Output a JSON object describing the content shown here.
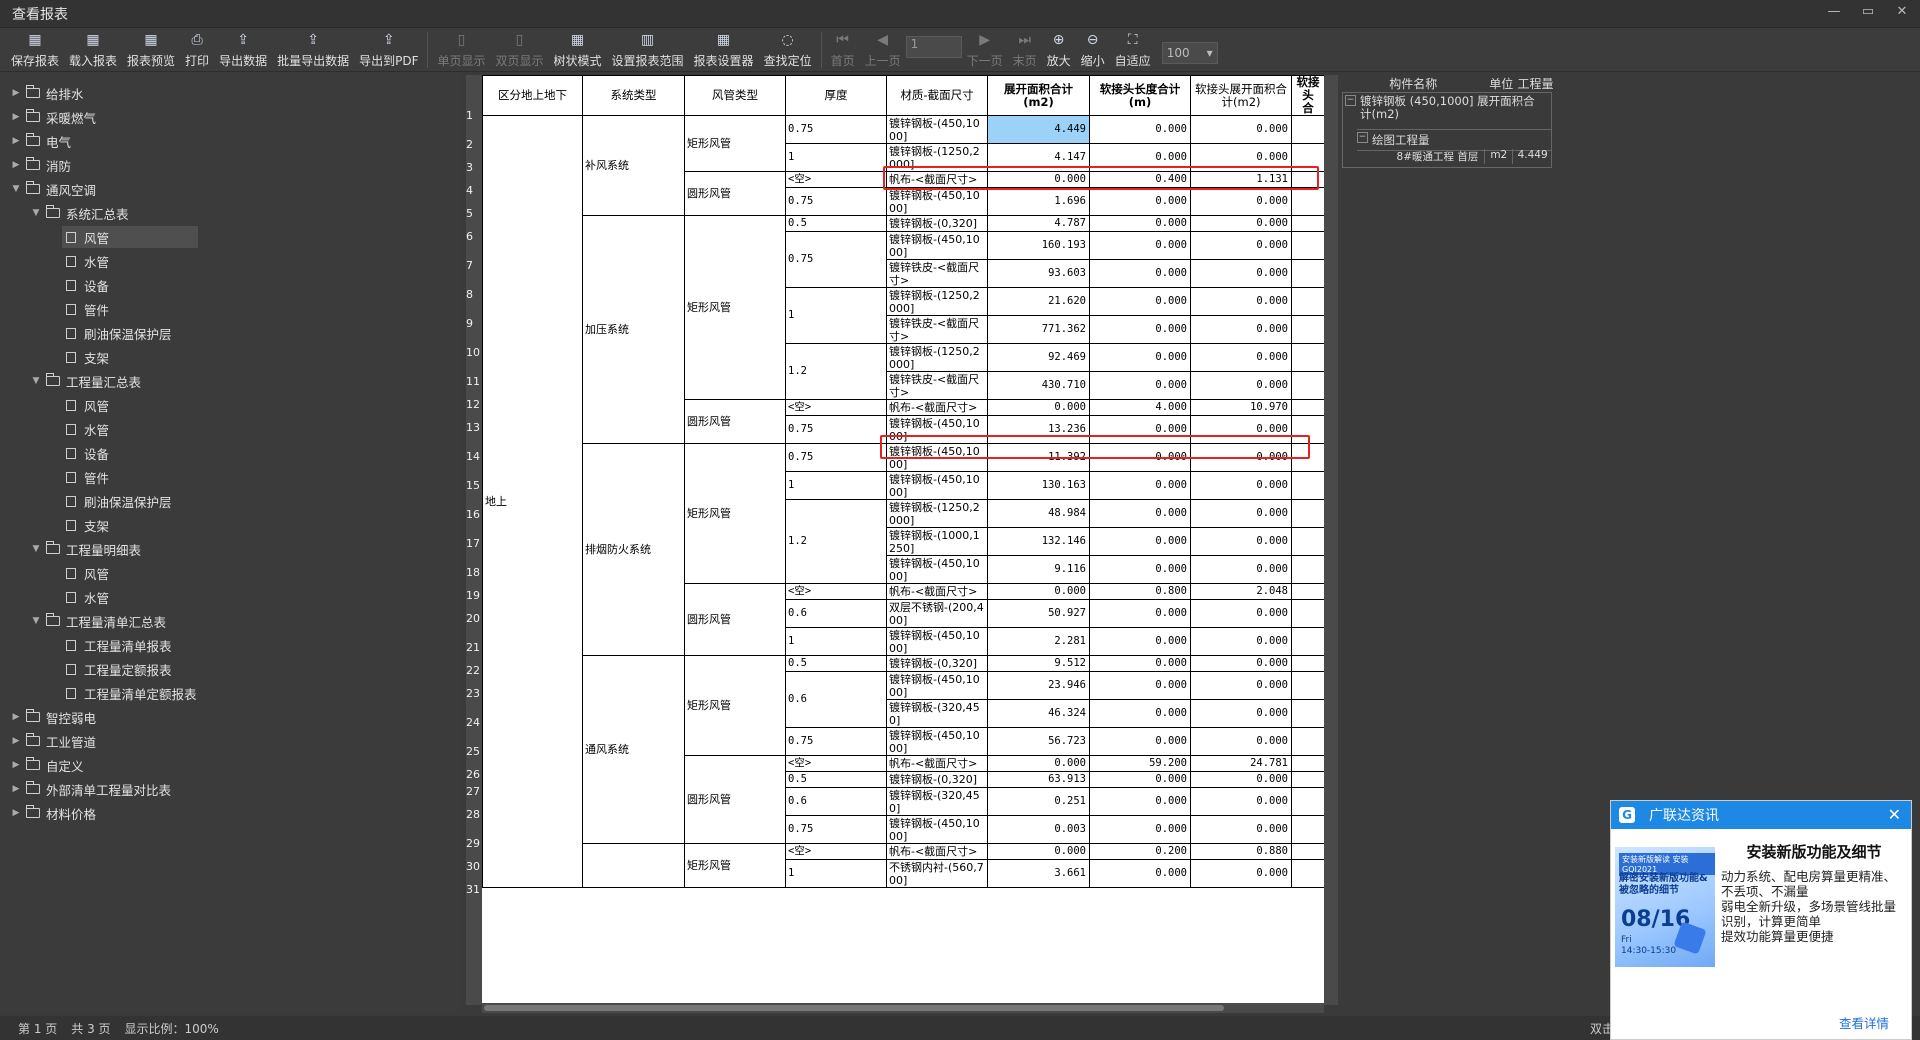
{
  "window": {
    "title": "查看报表",
    "controls": [
      "—",
      "▭",
      "✕"
    ]
  },
  "toolbar": {
    "buttons": [
      {
        "label": "保存报表",
        "icon": "save-icon",
        "glyph": "▦",
        "enabled": true
      },
      {
        "label": "载入报表",
        "icon": "load-icon",
        "glyph": "▦",
        "enabled": true
      },
      {
        "label": "报表预览",
        "icon": "preview-icon",
        "glyph": "▦",
        "enabled": true
      },
      {
        "label": "打印",
        "icon": "print-icon",
        "glyph": "⎙",
        "enabled": true
      },
      {
        "label": "导出数据",
        "icon": "export-icon",
        "glyph": "⇪",
        "enabled": true
      },
      {
        "label": "批量导出数据",
        "icon": "batch-export-icon",
        "glyph": "⇪",
        "enabled": true
      },
      {
        "label": "导出到PDF",
        "icon": "pdf-icon",
        "glyph": "⇪",
        "enabled": true
      },
      {
        "label": "单页显示",
        "icon": "single-page-icon",
        "glyph": "▯",
        "enabled": false
      },
      {
        "label": "双页显示",
        "icon": "double-page-icon",
        "glyph": "▯",
        "enabled": false
      },
      {
        "label": "树状模式",
        "icon": "tree-mode-icon",
        "glyph": "▦",
        "enabled": true
      },
      {
        "label": "设置报表范围",
        "icon": "range-icon",
        "glyph": "▥",
        "enabled": true
      },
      {
        "label": "报表设置器",
        "icon": "settings-icon",
        "glyph": "▦",
        "enabled": true
      },
      {
        "label": "查找定位",
        "icon": "locate-icon",
        "glyph": "◌",
        "enabled": true
      },
      {
        "label": "首页",
        "icon": "first-page-icon",
        "glyph": "⏮",
        "enabled": false
      },
      {
        "label": "上一页",
        "icon": "prev-page-icon",
        "glyph": "◀",
        "enabled": false
      }
    ],
    "page_input": "1",
    "buttons2": [
      {
        "label": "下一页",
        "icon": "next-page-icon",
        "glyph": "▶",
        "enabled": false
      },
      {
        "label": "末页",
        "icon": "last-page-icon",
        "glyph": "⏭",
        "enabled": false
      },
      {
        "label": "放大",
        "icon": "zoom-in-icon",
        "glyph": "⊕",
        "enabled": true
      },
      {
        "label": "缩小",
        "icon": "zoom-out-icon",
        "glyph": "⊖",
        "enabled": true
      },
      {
        "label": "自适应",
        "icon": "fit-icon",
        "glyph": "⛶",
        "enabled": true
      }
    ],
    "zoom_value": "100"
  },
  "sidebar": {
    "items": [
      {
        "label": "给排水",
        "level": 0,
        "type": "folder",
        "expanded": false
      },
      {
        "label": "采暖燃气",
        "level": 0,
        "type": "folder",
        "expanded": false
      },
      {
        "label": "电气",
        "level": 0,
        "type": "folder",
        "expanded": false
      },
      {
        "label": "消防",
        "level": 0,
        "type": "folder",
        "expanded": false
      },
      {
        "label": "通风空调",
        "level": 0,
        "type": "folder",
        "expanded": true
      },
      {
        "label": "系统汇总表",
        "level": 1,
        "type": "folder",
        "expanded": true
      },
      {
        "label": "风管",
        "level": 2,
        "type": "doc",
        "selected": true
      },
      {
        "label": "水管",
        "level": 2,
        "type": "doc"
      },
      {
        "label": "设备",
        "level": 2,
        "type": "doc"
      },
      {
        "label": "管件",
        "level": 2,
        "type": "doc"
      },
      {
        "label": "刷油保温保护层",
        "level": 2,
        "type": "doc"
      },
      {
        "label": "支架",
        "level": 2,
        "type": "doc"
      },
      {
        "label": "工程量汇总表",
        "level": 1,
        "type": "folder",
        "expanded": true
      },
      {
        "label": "风管",
        "level": 2,
        "type": "doc"
      },
      {
        "label": "水管",
        "level": 2,
        "type": "doc"
      },
      {
        "label": "设备",
        "level": 2,
        "type": "doc"
      },
      {
        "label": "管件",
        "level": 2,
        "type": "doc"
      },
      {
        "label": "刷油保温保护层",
        "level": 2,
        "type": "doc"
      },
      {
        "label": "支架",
        "level": 2,
        "type": "doc"
      },
      {
        "label": "工程量明细表",
        "level": 1,
        "type": "folder",
        "expanded": true
      },
      {
        "label": "风管",
        "level": 2,
        "type": "doc"
      },
      {
        "label": "水管",
        "level": 2,
        "type": "doc"
      },
      {
        "label": "工程量清单汇总表",
        "level": 1,
        "type": "folder",
        "expanded": true
      },
      {
        "label": "工程量清单报表",
        "level": 2,
        "type": "doc"
      },
      {
        "label": "工程量定额报表",
        "level": 2,
        "type": "doc"
      },
      {
        "label": "工程量清单定额报表",
        "level": 2,
        "type": "doc"
      },
      {
        "label": "智控弱电",
        "level": 0,
        "type": "folder",
        "expanded": false
      },
      {
        "label": "工业管道",
        "level": 0,
        "type": "folder",
        "expanded": false
      },
      {
        "label": "自定义",
        "level": 0,
        "type": "folder",
        "expanded": false
      },
      {
        "label": "外部清单工程量对比表",
        "level": 0,
        "type": "folder",
        "expanded": false
      },
      {
        "label": "材料价格",
        "level": 0,
        "type": "folder",
        "expanded": false
      }
    ]
  },
  "report": {
    "columns": [
      "区分地上地下",
      "系统类型",
      "风管类型",
      "厚度",
      "材质-截面尺寸",
      "展开面积合计\n(m2)",
      "软接头长度合计\n(m)",
      "软接头展开面积合\n计(m2)",
      "软接头\n合"
    ],
    "row_numbers": [
      "1",
      "2",
      "3",
      "4",
      "5",
      "6",
      "7",
      "8",
      "9",
      "10",
      "11",
      "12",
      "13",
      "14",
      "15",
      "16",
      "17",
      "18",
      "19",
      "20",
      "21",
      "22",
      "23",
      "24",
      "25",
      "26",
      "27",
      "28",
      "29",
      "30",
      "31"
    ],
    "level_label": "地上",
    "systems": [
      {
        "name": "补风系统",
        "groups": [
          {
            "duct": "矩形风管",
            "rows": [
              {
                "thk": "0.75",
                "mat": "镀锌钢板-(450,1000]",
                "a": "4.449",
                "b": "0.000",
                "c": "0.000",
                "h": 28
              },
              {
                "thk": "1",
                "mat": "镀锌钢板-(1250,2000]",
                "a": "4.147",
                "b": "0.000",
                "c": "0.000",
                "h": 28
              }
            ]
          },
          {
            "duct": "圆形风管",
            "rows": [
              {
                "thk": "<空>",
                "mat": "帆布-<截面尺寸>",
                "a": "0.000",
                "b": "0.400",
                "c": "1.131",
                "h": 16
              },
              {
                "thk": "0.75",
                "mat": "镀锌钢板-(450,1000]",
                "a": "1.696",
                "b": "0.000",
                "c": "0.000",
                "h": 28
              }
            ]
          }
        ]
      },
      {
        "name": "加压系统",
        "groups": [
          {
            "duct": "矩形风管",
            "rows": [
              {
                "thk": "0.5",
                "mat": "镀锌钢板-(0,320]",
                "a": "4.787",
                "b": "0.000",
                "c": "0.000",
                "h": 16
              },
              {
                "thk": "0.75",
                "mat": "镀锌钢板-(450,1000]",
                "a": "160.193",
                "b": "0.000",
                "c": "0.000",
                "h": 28
              },
              {
                "thk": "",
                "mat": "镀锌铁皮-<截面尺寸>",
                "a": "93.603",
                "b": "0.000",
                "c": "0.000",
                "h": 28
              },
              {
                "thk": "1",
                "mat": "镀锌钢板-(1250,2000]",
                "a": "21.620",
                "b": "0.000",
                "c": "0.000",
                "h": 28
              },
              {
                "thk": "",
                "mat": "镀锌铁皮-<截面尺寸>",
                "a": "771.362",
                "b": "0.000",
                "c": "0.000",
                "h": 28
              },
              {
                "thk": "1.2",
                "mat": "镀锌钢板-(1250,2000]",
                "a": "92.469",
                "b": "0.000",
                "c": "0.000",
                "h": 28
              },
              {
                "thk": "",
                "mat": "镀锌铁皮-<截面尺寸>",
                "a": "430.710",
                "b": "0.000",
                "c": "0.000",
                "h": 28
              }
            ]
          },
          {
            "duct": "圆形风管",
            "rows": [
              {
                "thk": "<空>",
                "mat": "帆布-<截面尺寸>",
                "a": "0.000",
                "b": "4.000",
                "c": "10.970",
                "h": 16
              },
              {
                "thk": "0.75",
                "mat": "镀锌钢板-(450,1000]",
                "a": "13.236",
                "b": "0.000",
                "c": "0.000",
                "h": 28
              }
            ]
          }
        ]
      },
      {
        "name": "排烟防火系统",
        "groups": [
          {
            "duct": "矩形风管",
            "rows": [
              {
                "thk": "0.75",
                "mat": "镀锌钢板-(450,1000]",
                "a": "11.392",
                "b": "0.000",
                "c": "0.000",
                "h": 28
              },
              {
                "thk": "1",
                "mat": "镀锌钢板-(450,1000]",
                "a": "130.163",
                "b": "0.000",
                "c": "0.000",
                "h": 28
              },
              {
                "thk": "1.2",
                "mat": "镀锌钢板-(1250,2000]",
                "a": "48.984",
                "b": "0.000",
                "c": "0.000",
                "h": 28
              },
              {
                "thk": "",
                "mat": "镀锌钢板-(1000,1250]",
                "a": "132.146",
                "b": "0.000",
                "c": "0.000",
                "h": 28
              },
              {
                "thk": "",
                "mat": "镀锌钢板-(450,1000]",
                "a": "9.116",
                "b": "0.000",
                "c": "0.000",
                "h": 28
              }
            ]
          },
          {
            "duct": "圆形风管",
            "rows": [
              {
                "thk": "<空>",
                "mat": "帆布-<截面尺寸>",
                "a": "0.000",
                "b": "0.800",
                "c": "2.048",
                "h": 16
              },
              {
                "thk": "0.6",
                "mat": "双层不锈钢-(200,400]",
                "a": "50.927",
                "b": "0.000",
                "c": "0.000",
                "h": 28
              },
              {
                "thk": "1",
                "mat": "镀锌钢板-(450,1000]",
                "a": "2.281",
                "b": "0.000",
                "c": "0.000",
                "h": 28
              }
            ]
          }
        ]
      },
      {
        "name": "通风系统",
        "groups": [
          {
            "duct": "矩形风管",
            "rows": [
              {
                "thk": "0.5",
                "mat": "镀锌钢板-(0,320]",
                "a": "9.512",
                "b": "0.000",
                "c": "0.000",
                "h": 16
              },
              {
                "thk": "0.6",
                "mat": "镀锌钢板-(450,1000]",
                "a": "23.946",
                "b": "0.000",
                "c": "0.000",
                "h": 28
              },
              {
                "thk": "",
                "mat": "镀锌钢板-(320,450]",
                "a": "46.324",
                "b": "0.000",
                "c": "0.000",
                "h": 28
              },
              {
                "thk": "0.75",
                "mat": "镀锌钢板-(450,1000]",
                "a": "56.723",
                "b": "0.000",
                "c": "0.000",
                "h": 28
              }
            ]
          },
          {
            "duct": "圆形风管",
            "rows": [
              {
                "thk": "<空>",
                "mat": "帆布-<截面尺寸>",
                "a": "0.000",
                "b": "59.200",
                "c": "24.781",
                "h": 16
              },
              {
                "thk": "0.5",
                "mat": "镀锌钢板-(0,320]",
                "a": "63.913",
                "b": "0.000",
                "c": "0.000",
                "h": 16
              },
              {
                "thk": "0.6",
                "mat": "镀锌钢板-(320,450]",
                "a": "0.251",
                "b": "0.000",
                "c": "0.000",
                "h": 28
              },
              {
                "thk": "0.75",
                "mat": "镀锌钢板-(450,1000]",
                "a": "0.003",
                "b": "0.000",
                "c": "0.000",
                "h": 28
              }
            ]
          }
        ]
      },
      {
        "name": "",
        "groups": [
          {
            "duct": "矩形风管",
            "rows": [
              {
                "thk": "<空>",
                "mat": "帆布-<截面尺寸>",
                "a": "0.000",
                "b": "0.200",
                "c": "0.880",
                "h": 16
              },
              {
                "thk": "1",
                "mat": "不锈钢内衬-(560,700]",
                "a": "3.661",
                "b": "0.000",
                "c": "0.000",
                "h": 28
              }
            ]
          }
        ]
      }
    ]
  },
  "detail_panel": {
    "headers": [
      "构件名称",
      "单位",
      "工程量"
    ],
    "group_label": "镀锌钢板 (450,1000] 展开面积合计(m2)",
    "sub_label": "绘图工程量",
    "row": {
      "name": "8#暖通工程 首层",
      "unit": "m2",
      "qty": "4.449"
    }
  },
  "statusbar": {
    "page_label": "第 1 页",
    "total_label": "共 3 页",
    "scale_label": "显示比例：100%",
    "hint": "双击"
  },
  "popup": {
    "header": "广联达资讯",
    "title": "安装新版功能及细节",
    "text": "动力系统、配电房算量更精准、不丢项、不漏量\n弱电全新升级，多场景管线批量识别，计算更简单\n提效功能算量更便捷",
    "link": "查看详情",
    "image": {
      "badge": "安装新版解读  安装GQI2021",
      "heading": "解密安装新版功能&被忽略的细节",
      "date": "08/16",
      "time": "Fri\n14:30-15:30"
    }
  }
}
